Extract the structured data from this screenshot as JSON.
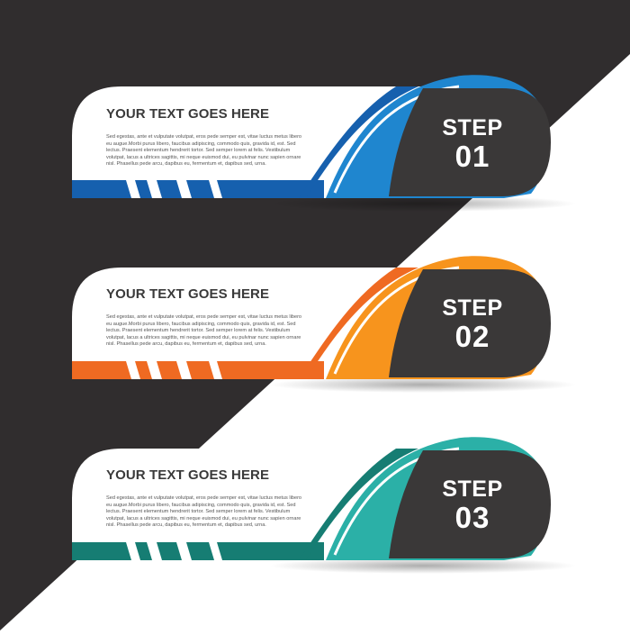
{
  "palette": {
    "background_dark": "#302d2e",
    "card": "#ffffff",
    "tab": "#3a3838"
  },
  "steps": [
    {
      "heading": "YOUR TEXT GOES HERE",
      "body": "Sed egestas, ante et vulputate volutpat, eros pede semper est, vitae luctus metus libero eu augue.Morbi purus libero, faucibus adipiscing, commodo quis, gravida id, est. Sed lectus. Praesent elementum hendrerit tortor. Sed semper lorem at felis. Vestibulum volutpat, lacus a ultrices sagittis, mi neque euismod dui, eu pulvinar nunc sapien ornare nisl. Phasellus pede arcu, dapibus eu, fermentum et, dapibus sed, urna.",
      "step_word": "STEP",
      "step_number": "01",
      "color_main": "#1f86cf",
      "color_dark": "#1660ae"
    },
    {
      "heading": "YOUR TEXT GOES HERE",
      "body": "Sed egestas, ante et vulputate volutpat, eros pede semper est, vitae luctus metus libero eu augue.Morbi purus libero, faucibus adipiscing, commodo quis, gravida id, est. Sed lectus. Praesent elementum hendrerit tortor. Sed semper lorem at felis. Vestibulum volutpat, lacus a ultrices sagittis, mi neque euismod dui, eu pulvinar nunc sapien ornare nisl. Phasellus pede arcu, dapibus eu, fermentum et, dapibus sed, urna.",
      "step_word": "STEP",
      "step_number": "02",
      "color_main": "#f7941d",
      "color_dark": "#ef6a22"
    },
    {
      "heading": "YOUR TEXT GOES HERE",
      "body": "Sed egestas, ante et vulputate volutpat, eros pede semper est, vitae luctus metus libero eu augue.Morbi purus libero, faucibus adipiscing, commodo quis, gravida id, est. Sed lectus. Praesent elementum hendrerit tortor. Sed semper lorem at felis. Vestibulum volutpat, lacus a ultrices sagittis, mi neque euismod dui, eu pulvinar nunc sapien ornare nisl. Phasellus pede arcu, dapibus eu, fermentum et, dapibus sed, urna.",
      "step_word": "STEP",
      "step_number": "03",
      "color_main": "#2bb0a7",
      "color_dark": "#167d73"
    }
  ]
}
